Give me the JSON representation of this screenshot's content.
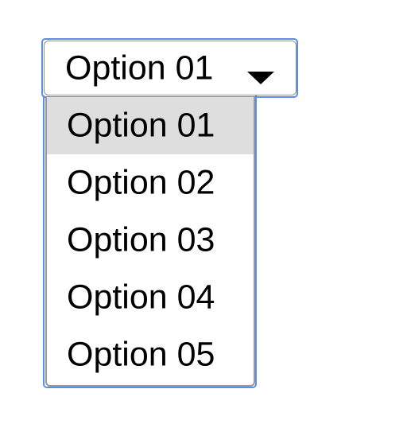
{
  "select": {
    "value": "Option 01",
    "arrow_icon": "caret-down-icon",
    "focus_color": "#5b8ee6"
  },
  "listbox": {
    "selected_index": 0,
    "highlight_color": "#dedede",
    "options": [
      {
        "label": "Option 01"
      },
      {
        "label": "Option 02"
      },
      {
        "label": "Option 03"
      },
      {
        "label": "Option 04"
      },
      {
        "label": "Option 05"
      }
    ]
  }
}
